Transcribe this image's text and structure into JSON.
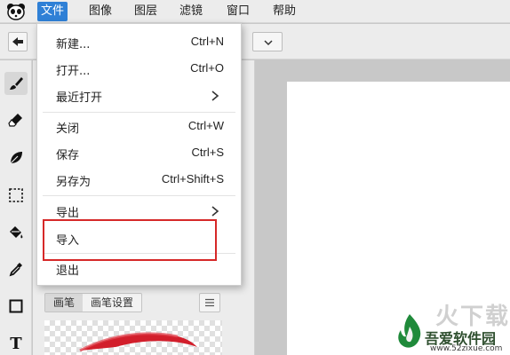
{
  "menubar": {
    "logo_icon": "panda-logo-icon",
    "items": [
      "文件",
      "图像",
      "图层",
      "滤镜",
      "窗口",
      "帮助"
    ],
    "active_color": "#2f80d6"
  },
  "toolbar": {
    "undo_icon": "arrow-left-icon",
    "combo_icon": "chevron-down-icon"
  },
  "tools": [
    "brush-icon",
    "eraser-icon",
    "leaf-icon",
    "selection-icon",
    "bucket-icon",
    "eyedropper-icon",
    "rectangle-icon",
    "text-icon"
  ],
  "tool_text_glyph": "T",
  "panel": {
    "tabs": [
      "画笔",
      "画笔设置"
    ],
    "menu_icon": "hamburger-icon"
  },
  "file_menu": {
    "items": [
      {
        "label": "新建...",
        "shortcut": "Ctrl+N",
        "submenu": false
      },
      {
        "label": "打开...",
        "shortcut": "Ctrl+O",
        "submenu": false
      },
      {
        "label": "最近打开",
        "shortcut": "",
        "submenu": true
      },
      {
        "label": "关闭",
        "shortcut": "Ctrl+W",
        "submenu": false
      },
      {
        "label": "保存",
        "shortcut": "Ctrl+S",
        "submenu": false
      },
      {
        "label": "另存为",
        "shortcut": "Ctrl+Shift+S",
        "submenu": false
      },
      {
        "label": "导出",
        "shortcut": "",
        "submenu": true
      },
      {
        "label": "导入",
        "shortcut": "",
        "submenu": false
      },
      {
        "label": "退出",
        "shortcut": "",
        "submenu": false
      }
    ],
    "highlighted_item": "导入",
    "highlight_color": "#d62828"
  },
  "watermark": {
    "big": "火下载",
    "site": "吾爱软件园",
    "url": "www.52zixue.com"
  }
}
